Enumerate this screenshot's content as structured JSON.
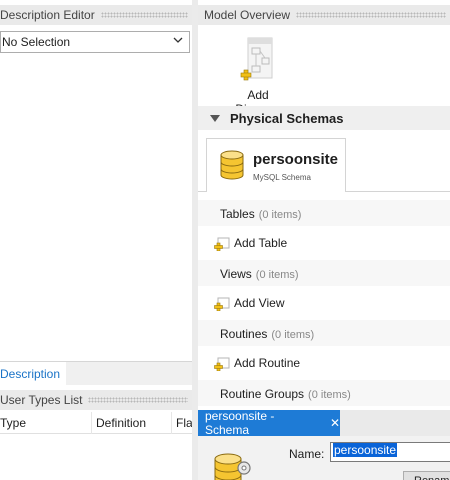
{
  "left_panel": {
    "description_editor": {
      "title": "Description Editor",
      "selection_value": "No Selection"
    },
    "bottom_tab": "Description",
    "user_types": {
      "title": "User Types List",
      "columns": [
        "Type",
        "Definition",
        "Flag"
      ]
    }
  },
  "model_overview": {
    "title": "Model Overview",
    "add_diagram_label": "Add Diagram",
    "physical_schemas_title": "Physical Schemas",
    "schema": {
      "name": "persoonsite",
      "subtitle": "MySQL Schema"
    },
    "sections": [
      {
        "label": "Tables",
        "count": "(0 items)",
        "add_label": "Add Table"
      },
      {
        "label": "Views",
        "count": "(0 items)",
        "add_label": "Add View"
      },
      {
        "label": "Routines",
        "count": "(0 items)",
        "add_label": "Add Routine"
      },
      {
        "label": "Routine Groups",
        "count": "(0 items)"
      }
    ]
  },
  "schema_editor": {
    "tab_label": "persoonsite - Schema",
    "close_glyph": "✕",
    "name_label": "Name:",
    "name_value": "persoonsite",
    "rename_button": "Renam"
  },
  "colors": {
    "accent": "#1e7bd6",
    "link": "#1a73c7",
    "header_bg": "#eaeaea"
  },
  "icons": [
    "chevron-down-icon",
    "diagram-icon",
    "add-icon",
    "collapse-triangle-icon",
    "database-icon",
    "close-icon"
  ]
}
